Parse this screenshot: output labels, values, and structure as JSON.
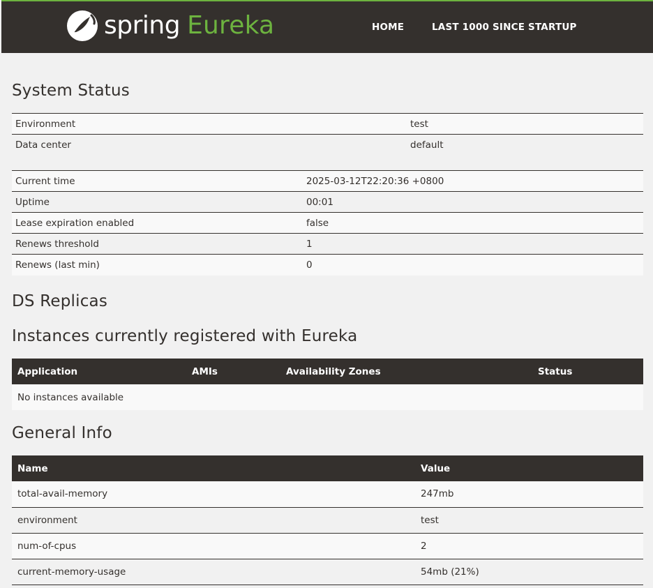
{
  "header": {
    "brand_spring": "spring",
    "brand_eureka": "Eureka",
    "nav": {
      "home": "HOME",
      "last1000": "LAST 1000 SINCE STARTUP"
    }
  },
  "colors": {
    "header_bg": "#34302d",
    "brand_green": "#6db33f",
    "page_bg": "#f1f1f1"
  },
  "system_status": {
    "title": "System Status",
    "env_rows": [
      {
        "label": "Environment",
        "value": "test"
      },
      {
        "label": "Data center",
        "value": "default"
      }
    ],
    "status_rows": [
      {
        "label": "Current time",
        "value": "2025-03-12T22:20:36 +0800"
      },
      {
        "label": "Uptime",
        "value": "00:01"
      },
      {
        "label": "Lease expiration enabled",
        "value": "false"
      },
      {
        "label": "Renews threshold",
        "value": "1"
      },
      {
        "label": "Renews (last min)",
        "value": "0"
      }
    ]
  },
  "ds_replicas": {
    "title": "DS Replicas"
  },
  "instances": {
    "title": "Instances currently registered with Eureka",
    "columns": [
      "Application",
      "AMIs",
      "Availability Zones",
      "Status"
    ],
    "empty_message": "No instances available"
  },
  "general_info": {
    "title": "General Info",
    "columns": [
      "Name",
      "Value"
    ],
    "rows": [
      {
        "name": "total-avail-memory",
        "value": "247mb"
      },
      {
        "name": "environment",
        "value": "test"
      },
      {
        "name": "num-of-cpus",
        "value": "2"
      },
      {
        "name": "current-memory-usage",
        "value": "54mb (21%)"
      }
    ]
  }
}
